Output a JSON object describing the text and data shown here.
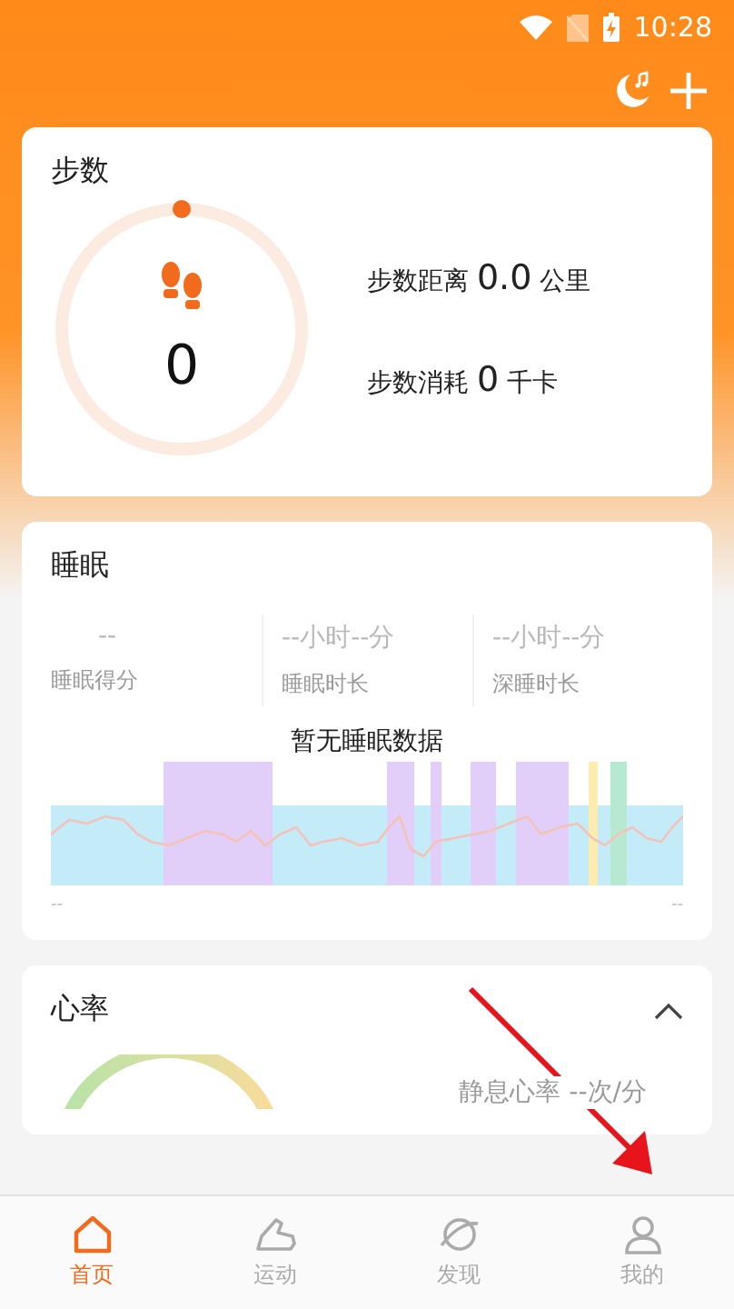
{
  "status_bar": {
    "time": "10:28"
  },
  "steps": {
    "title": "步数",
    "count": "0",
    "level": 0,
    "distance_label": "步数距离",
    "distance_value": "0.0",
    "distance_unit": "公里",
    "calories_label": "步数消耗",
    "calories_value": "0",
    "calories_unit": "千卡"
  },
  "sleep": {
    "title": "睡眠",
    "stats": [
      {
        "value": "--",
        "label": "睡眠得分"
      },
      {
        "value": "--小时--分",
        "label": "睡眠时长"
      },
      {
        "value": "--小时--分",
        "label": "深睡时长"
      }
    ],
    "empty_message": "暂无睡眠数据",
    "start_time": "--",
    "end_time": "--"
  },
  "heart_rate": {
    "title": "心率",
    "expanded": true,
    "resting_label": "静息心率",
    "resting_value": "--次/分"
  },
  "nav": [
    {
      "label": "首页",
      "selected": true
    },
    {
      "label": "运动",
      "selected": false
    },
    {
      "label": "发现",
      "selected": false
    },
    {
      "label": "我的",
      "selected": false
    }
  ]
}
